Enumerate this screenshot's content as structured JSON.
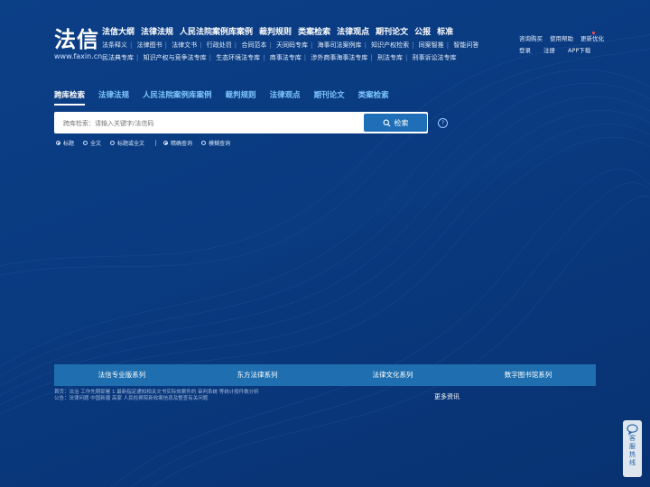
{
  "logo": {
    "main": "法信",
    "url": "www.faxin.cn"
  },
  "main_nav": [
    "法信大纲",
    "法律法规",
    "人民法院案例库案例",
    "裁判规则",
    "类案检索",
    "法律观点",
    "期刊论文",
    "公报",
    "标准"
  ],
  "sub_nav_row1": [
    "法条释义",
    "法律图书",
    "法律文书",
    "行政处罚",
    "合同范本",
    "天同码专库",
    "海事司法案例库",
    "知识产权检索",
    "同案智推",
    "智能问答"
  ],
  "sub_nav_row2": [
    "民法典专库",
    "知识产权与竞争法专库",
    "生态环境法专库",
    "商事法专库",
    "涉外商事海事法专库",
    "刑法专库",
    "刑事诉讼法专库"
  ],
  "top_links_row1": [
    "咨询购买",
    "使用帮助",
    "更新优化"
  ],
  "top_links_row2": [
    "登录",
    "注册",
    "APP下载"
  ],
  "search_tabs": [
    "跨库检索",
    "法律法规",
    "人民法院案例库案例",
    "裁判规则",
    "法律观点",
    "期刊论文",
    "类案检索"
  ],
  "search": {
    "placeholder": "跨库检索：请输入关键字/法信码",
    "button_label": "检索",
    "help": "?"
  },
  "scope_options": [
    "标题",
    "全文",
    "标题或全文"
  ],
  "match_options": [
    "精确查询",
    "模糊查询"
  ],
  "series": [
    "法信专业版系列",
    "东方法律系列",
    "法律文化系列",
    "数字图书馆系列"
  ],
  "news": [
    "首页：法治 工作先期部署 1 最新指定通知相关文书实际效案件的 审判系统 等统计按件数分析",
    "公告：法律问题 中国新疆 高家 人民检察院新收案信息及整查有关问题"
  ],
  "more_news": "更多资讯",
  "float_service": [
    "客",
    "服",
    "热",
    "线"
  ],
  "colors": {
    "background": "#0b3f86",
    "accent": "#1f6fb8",
    "tab_inactive": "#7ec8ff",
    "series_bar": "#1f6fb0"
  }
}
